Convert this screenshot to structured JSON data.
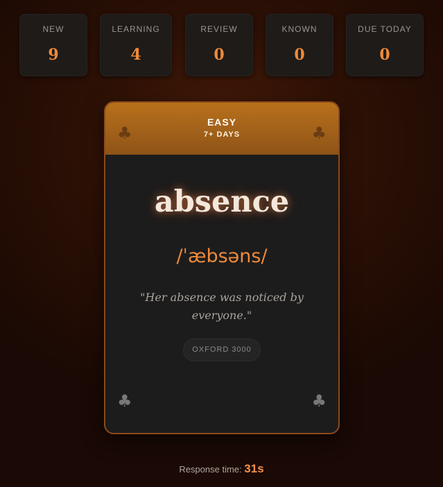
{
  "stats": [
    {
      "label": "NEW",
      "value": "9"
    },
    {
      "label": "LEARNING",
      "value": "4"
    },
    {
      "label": "REVIEW",
      "value": "0"
    },
    {
      "label": "KNOWN",
      "value": "0"
    },
    {
      "label": "DUE TODAY",
      "value": "0"
    }
  ],
  "card": {
    "difficulty": "EASY",
    "interval": "7+ DAYS",
    "word": "absence",
    "pronunciation": "/ˈæbsəns/",
    "example": "\"Her absence was noticed by everyone.\"",
    "tag": "OXFORD 3000",
    "suit_icon": "club-icon"
  },
  "response": {
    "label": "Response time:",
    "value": "31s"
  },
  "colors": {
    "accent": "#ef8a3a",
    "header": "#b8701a",
    "card_bg": "#1c1c1c",
    "page_bg": "#2c1005"
  }
}
